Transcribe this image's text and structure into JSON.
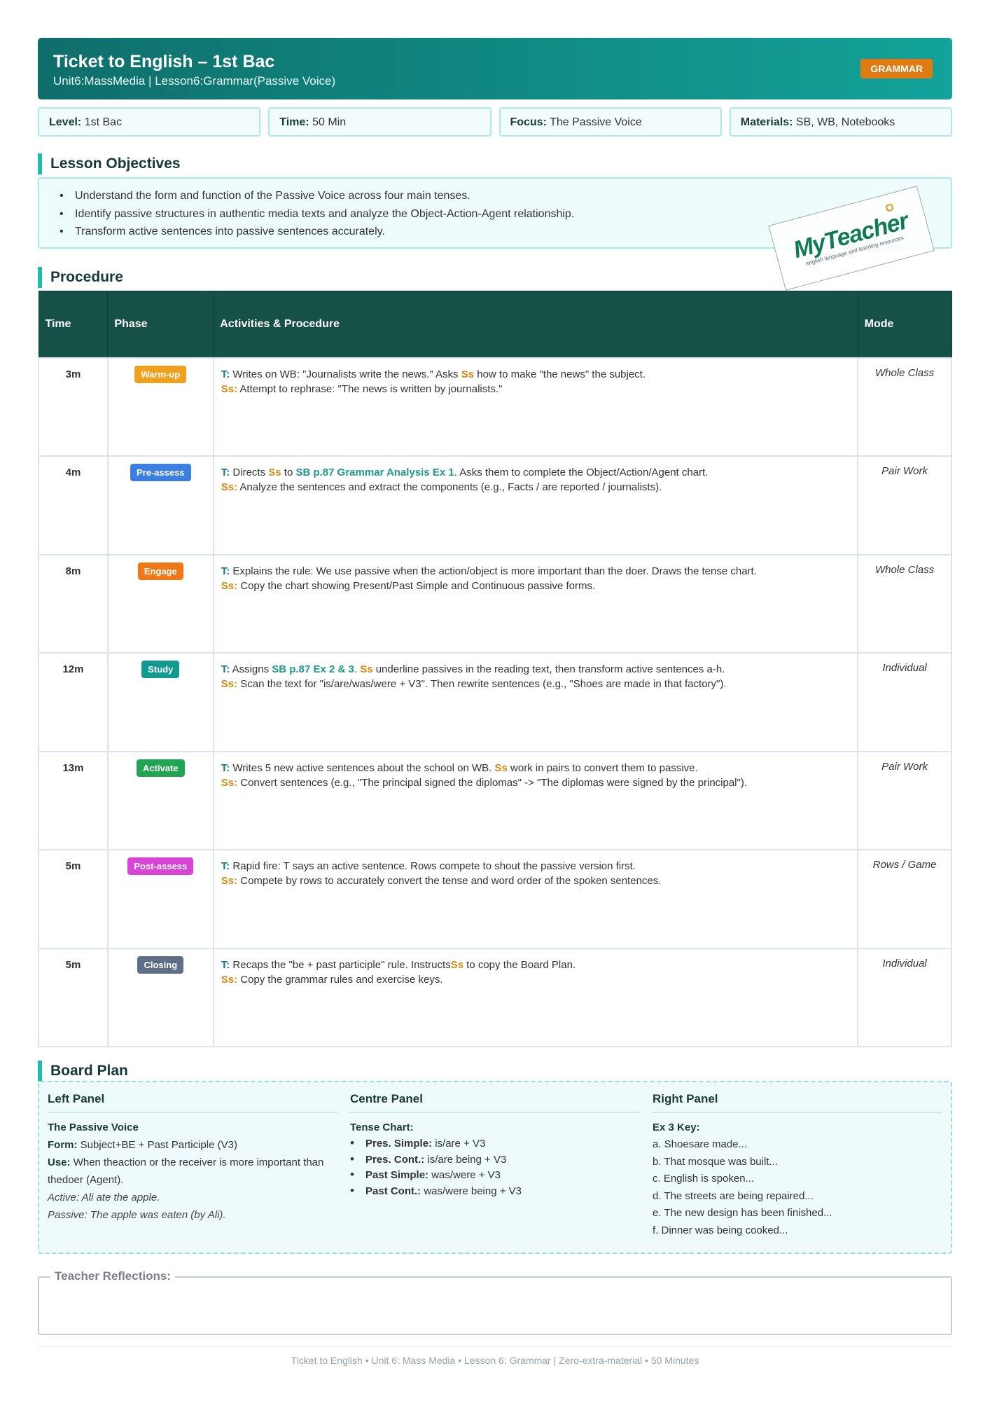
{
  "header": {
    "title": "Ticket to English – 1st Bac",
    "subtitle": "Unit6:MassMedia | Lesson6:Grammar(Passive Voice)",
    "badge": "GRAMMAR"
  },
  "info": [
    {
      "label": "Level:",
      "value": "1st Bac"
    },
    {
      "label": "Time:",
      "value": "50 Min"
    },
    {
      "label": "Focus:",
      "value": "The Passive Voice"
    },
    {
      "label": "Materials:",
      "value": "SB, WB, Notebooks"
    }
  ],
  "objectives": {
    "title": "Lesson Objectives",
    "items": [
      "Understand the form and function of the Passive Voice across four main tenses.",
      "Identify passive structures in authentic media texts and analyze the Object-Action-Agent relationship.",
      "Transform active sentences into passive sentences accurately."
    ]
  },
  "stamp": {
    "logo": "MyTeacher",
    "tagline": "english language and learning resources"
  },
  "procedure": {
    "title": "Procedure",
    "headers": {
      "time": "Time",
      "phase": "Phase",
      "activities": "Activities & Procedure",
      "mode": "Mode"
    },
    "t_label": "T:",
    "s_label": "Ss:",
    "rows": [
      {
        "time": "3m",
        "phase": "Warm-up",
        "color": "#f0a11b",
        "mode": "Whole Class",
        "t": [
          "Writes on WB: \"Journalists write the news.\" Asks ",
          "Ss",
          " how to make \"the news\" the subject."
        ],
        "s": "Attempt to rephrase: \"The news is written by journalists.\""
      },
      {
        "time": "4m",
        "phase": "Pre-assess",
        "color": "#3b7fe0",
        "mode": "Pair Work",
        "t": [
          "Directs ",
          "Ss",
          " to ",
          "SB p.87 Grammar Analysis Ex 1",
          ". Asks them to complete the Object/Action/Agent chart."
        ],
        "s": "Analyze the sentences and extract the components (e.g., Facts / are reported / journalists)."
      },
      {
        "time": "8m",
        "phase": "Engage",
        "color": "#f07818",
        "mode": "Whole Class",
        "t": [
          "Explains the rule: We use passive when the action/object is more important than the doer. Draws the tense chart."
        ],
        "s": "Copy the chart showing Present/Past Simple and Continuous passive forms."
      },
      {
        "time": "12m",
        "phase": "Study",
        "color": "#139a90",
        "mode": "Individual",
        "t": [
          "Assigns ",
          "SB p.87 Ex 2 & 3",
          ". ",
          "Ss",
          " underline passives in the reading text, then transform active sentences a-h."
        ],
        "s": "Scan the text for \"is/are/was/were + V3\". Then rewrite sentences (e.g., \"Shoes are made in that factory\")."
      },
      {
        "time": "13m",
        "phase": "Activate",
        "color": "#22a552",
        "mode": "Pair Work",
        "t": [
          "Writes 5 new active sentences about the school on WB. ",
          "Ss",
          " work in pairs to convert them to passive."
        ],
        "s": "Convert sentences (e.g., \"The principal signed the diplomas\" -> \"The diplomas were signed by the principal\")."
      },
      {
        "time": "5m",
        "phase": "Post-assess",
        "color": "#d844d8",
        "mode": "Rows / Game",
        "t": [
          "Rapid fire: T says an active sentence. Rows compete to shout the passive version first."
        ],
        "s": "Compete by rows to accurately convert the tense and word order of the spoken sentences."
      },
      {
        "time": "5m",
        "phase": "Closing",
        "color": "#5f6e86",
        "mode": "Individual",
        "t": [
          "Recaps the \"be + past participle\" rule. Instructs",
          "Ss",
          " to copy the Board Plan."
        ],
        "s": "Copy the grammar rules and exercise keys."
      }
    ]
  },
  "board": {
    "title": "Board Plan",
    "left": {
      "heading": "Left Panel",
      "sub": "The Passive Voice",
      "form_label": "Form:",
      "form": "Subject+BE + Past Participle (V3)",
      "use_label": "Use:",
      "use": "When theaction or the receiver is more important than thedoer (Agent).",
      "active": "Active: Ali ate the apple.",
      "passive": "Passive: The apple was eaten (by Ali)."
    },
    "centre": {
      "heading": "Centre Panel",
      "sub": "Tense Chart:",
      "items": [
        {
          "label": "Pres. Simple:",
          "value": "is/are + V3"
        },
        {
          "label": "Pres. Cont.:",
          "value": "is/are being + V3"
        },
        {
          "label": "Past Simple:",
          "value": "was/were + V3"
        },
        {
          "label": "Past Cont.:",
          "value": "was/were being + V3"
        }
      ]
    },
    "right": {
      "heading": "Right Panel",
      "sub": "Ex 3 Key:",
      "items": [
        "a. Shoesare made...",
        "b. That mosque was built...",
        "c. English is spoken...",
        "d. The streets are being repaired...",
        "e. The new design has been finished...",
        "f. Dinner was being cooked..."
      ]
    }
  },
  "reflections": {
    "label": "Teacher Reflections:"
  },
  "footer": "Ticket to English • Unit 6: Mass Media • Lesson 6: Grammar | Zero-extra-material • 50 Minutes"
}
